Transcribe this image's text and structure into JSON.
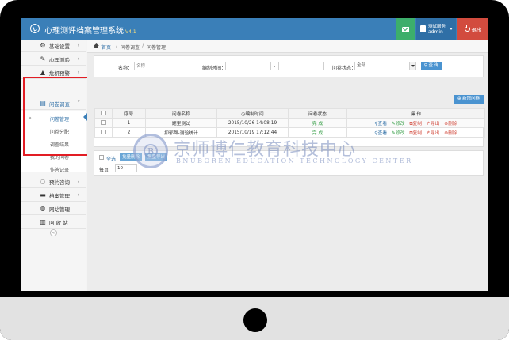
{
  "header": {
    "title": "心理测评档案管理系统",
    "version": "V4.1",
    "user_role": "测试服务",
    "user_name": "admin",
    "logout_label": "退出"
  },
  "sidebar": {
    "items": [
      {
        "label": "基础设置",
        "icon": "gears-icon"
      },
      {
        "label": "心理测验",
        "icon": "edit-icon"
      },
      {
        "label": "危机预警",
        "icon": "warning-icon"
      },
      {
        "label": "问卷调查",
        "icon": "document-icon"
      },
      {
        "label": "预约咨询",
        "icon": "chat-icon"
      },
      {
        "label": "档案管理",
        "icon": "folder-icon"
      },
      {
        "label": "网站管理",
        "icon": "globe-icon"
      },
      {
        "label": "回 收 站",
        "icon": "trash-icon"
      }
    ],
    "sub_items": [
      "问卷管理",
      "问卷分配",
      "调查结果",
      "我的问卷",
      "作答记录"
    ]
  },
  "breadcrumb": {
    "home": "首页",
    "level1": "问卷调查",
    "level2": "问卷管理"
  },
  "search": {
    "name_label": "名称：",
    "name_placeholder": "名称",
    "time_label": "编制时间：",
    "time_sep": "-",
    "status_label": "问卷状态：",
    "status_value": "全部",
    "button_label": "查 询"
  },
  "add_button": "新增问卷",
  "table": {
    "headers": [
      "",
      "序号",
      "问卷名称",
      "编制时间",
      "问卷状态",
      "操 作"
    ],
    "rows": [
      {
        "index": "1",
        "name": "题型测试",
        "time": "2015/10/26 14:08:19",
        "status": "完 成"
      },
      {
        "index": "2",
        "name": "抑郁群-测验统计",
        "time": "2015/10/19 17:12:44",
        "status": "完 成"
      }
    ],
    "ops": [
      "查看",
      "修改",
      "复制",
      "导出",
      "删除"
    ]
  },
  "footer": {
    "select_all": "全选",
    "batch_buttons": [
      "批量删除",
      "批量导出"
    ],
    "per_page_label": "每页",
    "per_page_value": "10"
  },
  "watermark": {
    "seal_letter": "B",
    "cn": "京师博仁教育科技中心",
    "en": "BNUBOREN EDUCATION TECHNOLOGY CENTER"
  },
  "colors": {
    "header": "#3a7fb8",
    "mail": "#3cae6b",
    "logout": "#d24b3e",
    "highlight_box": "#e21d24"
  }
}
